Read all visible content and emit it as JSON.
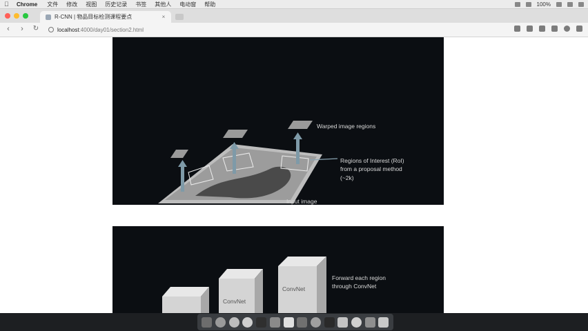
{
  "menubar": {
    "app_name": "Chrome",
    "items": [
      "文件",
      "修改",
      "视图",
      "历史记录",
      "书签",
      "其他人",
      "电动窗",
      "帮助"
    ],
    "battery": "100%",
    "icons": [
      "apple-icon",
      "wifi-icon",
      "volume-icon",
      "battery-icon",
      "search-icon",
      "menu-icon"
    ]
  },
  "tab": {
    "title": "R-CNN | 物品目标检测课程要点"
  },
  "toolbar": {
    "url_host": "localhost",
    "url_rest": ":4000/day01/section2.html"
  },
  "slide1": {
    "labels": {
      "warped": "Warped image regions",
      "roi_line1": "Regions of Interest (RoI)",
      "roi_line2": "from a proposal method",
      "roi_line3": "(~2k)",
      "input": "Input image"
    }
  },
  "slide2": {
    "labels": {
      "forward_line1": "Forward each region",
      "forward_line2": "through ConvNet",
      "convnet_a": "ConvNet",
      "convnet_b": "ConvNet"
    }
  },
  "colors": {
    "slide_bg": "#0b0e12",
    "arrow": "#7e9aa8",
    "panel": "#c9c9c9"
  }
}
